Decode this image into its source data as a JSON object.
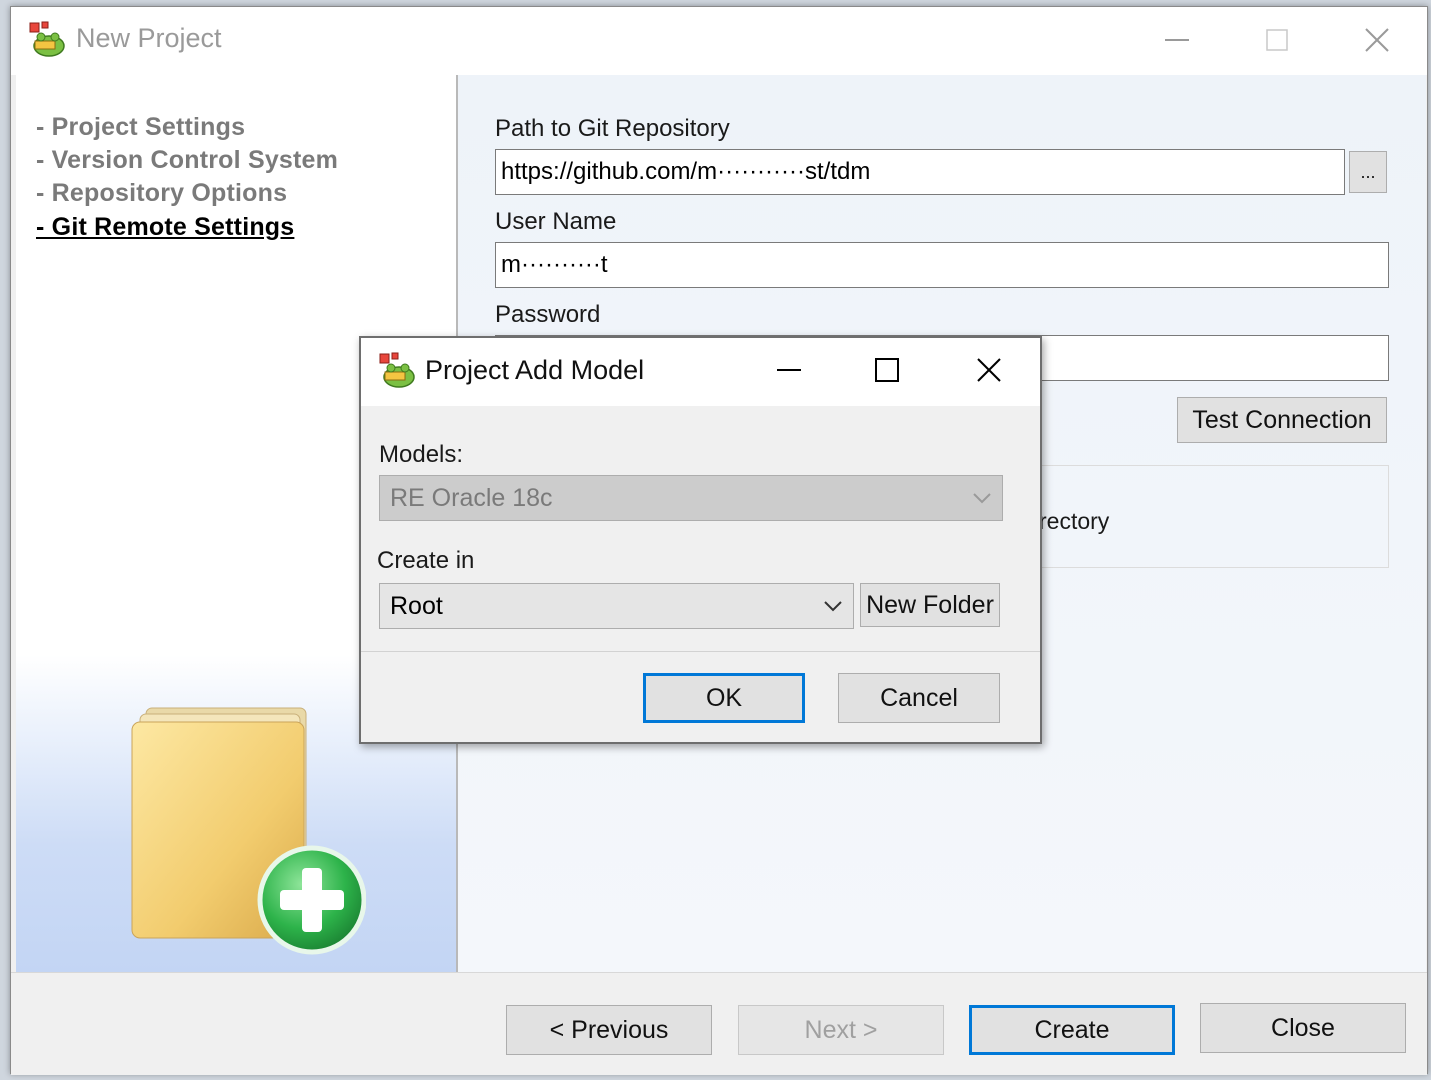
{
  "window": {
    "title": "New Project"
  },
  "nav": {
    "items": [
      {
        "label": "- Project  Settings"
      },
      {
        "label": "- Version  Control  System"
      },
      {
        "label": "- Repository  Options"
      },
      {
        "label": "- Git  Remote  Settings"
      }
    ],
    "active_index": 3
  },
  "form": {
    "path_label": "Path to Git Repository",
    "path_value": "https://github.com/m···········st/tdm",
    "browse_label": "...",
    "username_label": "User Name",
    "username_value": "m··········t",
    "password_label": "Password",
    "password_value": "",
    "test_connection_label": "Test Connection",
    "partial_option_text": "rectory"
  },
  "footer": {
    "previous_label": "< Previous",
    "next_label": "Next >",
    "create_label": "Create",
    "close_label": "Close"
  },
  "dialog": {
    "title": "Project Add Model",
    "models_label": "Models:",
    "models_value": "RE Oracle 18c",
    "create_in_label": "Create in",
    "create_in_value": "Root",
    "new_folder_label": "New Folder",
    "ok_label": "OK",
    "cancel_label": "Cancel"
  },
  "colors": {
    "accent": "#0078d7",
    "folder": "#f2cc6e",
    "plus_green": "#2db34a"
  },
  "icons": {
    "app": "toad-app-icon",
    "illustration": "folder-add-icon"
  }
}
